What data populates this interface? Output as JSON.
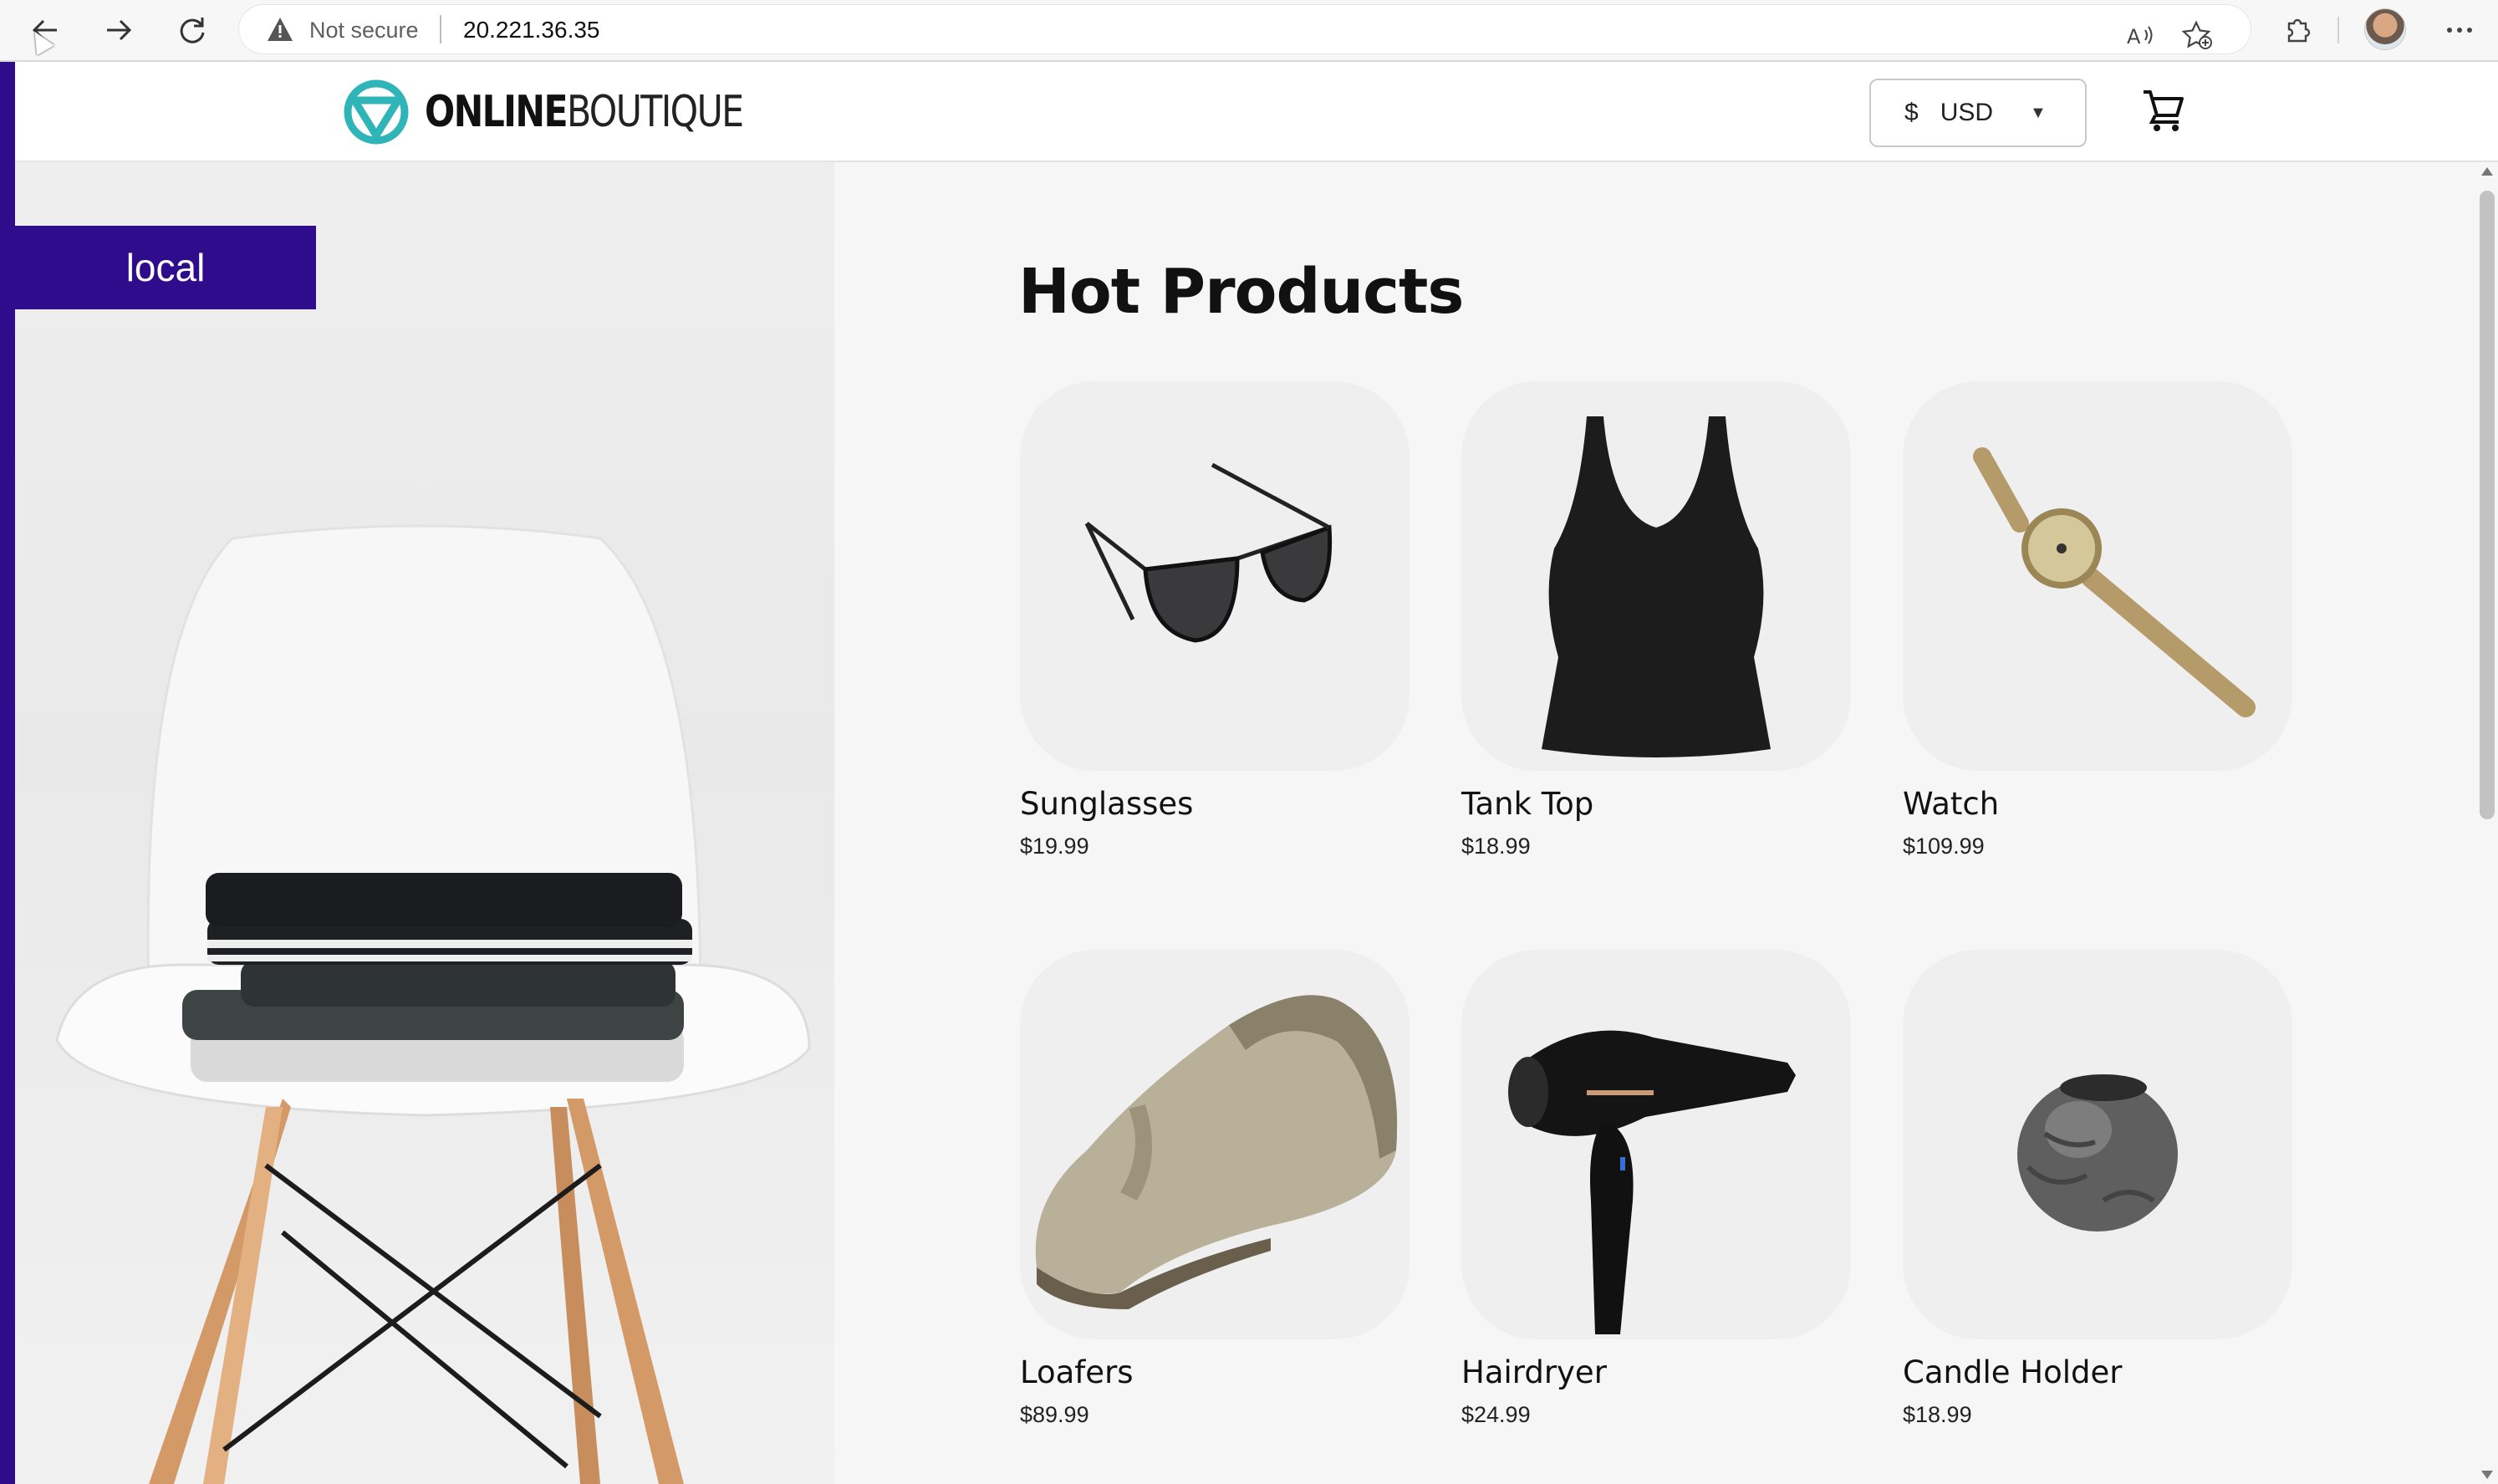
{
  "browser": {
    "security_label": "Not secure",
    "url": "20.221.36.35",
    "icons": [
      "back-arrow-icon",
      "forward-arrow-icon",
      "reload-icon",
      "warning-icon",
      "read-aloud-icon",
      "favorites-icon",
      "extensions-icon",
      "profile-avatar",
      "more-menu-icon"
    ]
  },
  "header": {
    "logo_bold": "ONLINE",
    "logo_light": "BOUTIQUE",
    "currency_symbol": "$",
    "currency_code": "USD",
    "accent_color": "#2e0c8c",
    "logo_color": "#2fb5b7"
  },
  "hero": {
    "env_label": "local"
  },
  "main": {
    "title": "Hot Products",
    "products": [
      {
        "name": "Sunglasses",
        "price": "$19.99"
      },
      {
        "name": "Tank Top",
        "price": "$18.99"
      },
      {
        "name": "Watch",
        "price": "$109.99"
      },
      {
        "name": "Loafers",
        "price": "$89.99"
      },
      {
        "name": "Hairdryer",
        "price": "$24.99"
      },
      {
        "name": "Candle Holder",
        "price": "$18.99"
      }
    ]
  }
}
